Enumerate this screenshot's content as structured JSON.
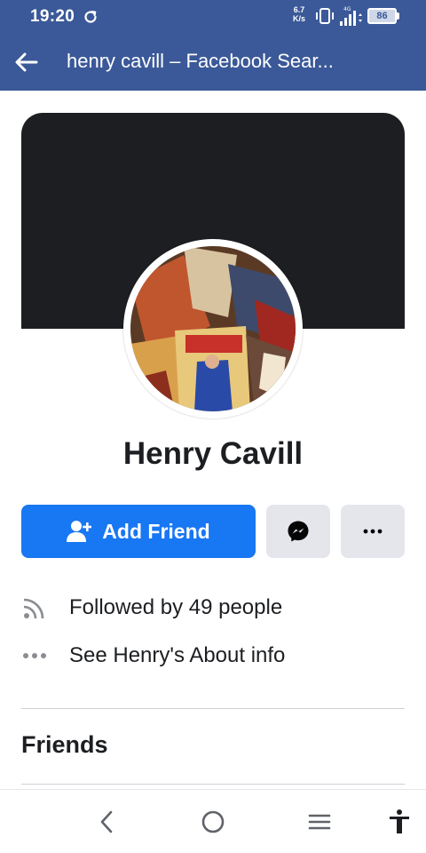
{
  "status_bar": {
    "time": "19:20",
    "net_speed_value": "6.7",
    "net_speed_unit": "K/s",
    "network_type": "4G",
    "battery": "86"
  },
  "app_bar": {
    "title": "henry cavill – Facebook Sear..."
  },
  "profile": {
    "name": "Henry Cavill"
  },
  "actions": {
    "add_friend_label": "Add Friend"
  },
  "info": {
    "followers": "Followed by 49 people",
    "about": "See Henry's About info"
  },
  "sections": {
    "friends_title": "Friends"
  },
  "colors": {
    "header": "#3b5998",
    "primary": "#1877f2",
    "secondary_button": "#e4e6eb",
    "cover": "#1c1e21"
  }
}
